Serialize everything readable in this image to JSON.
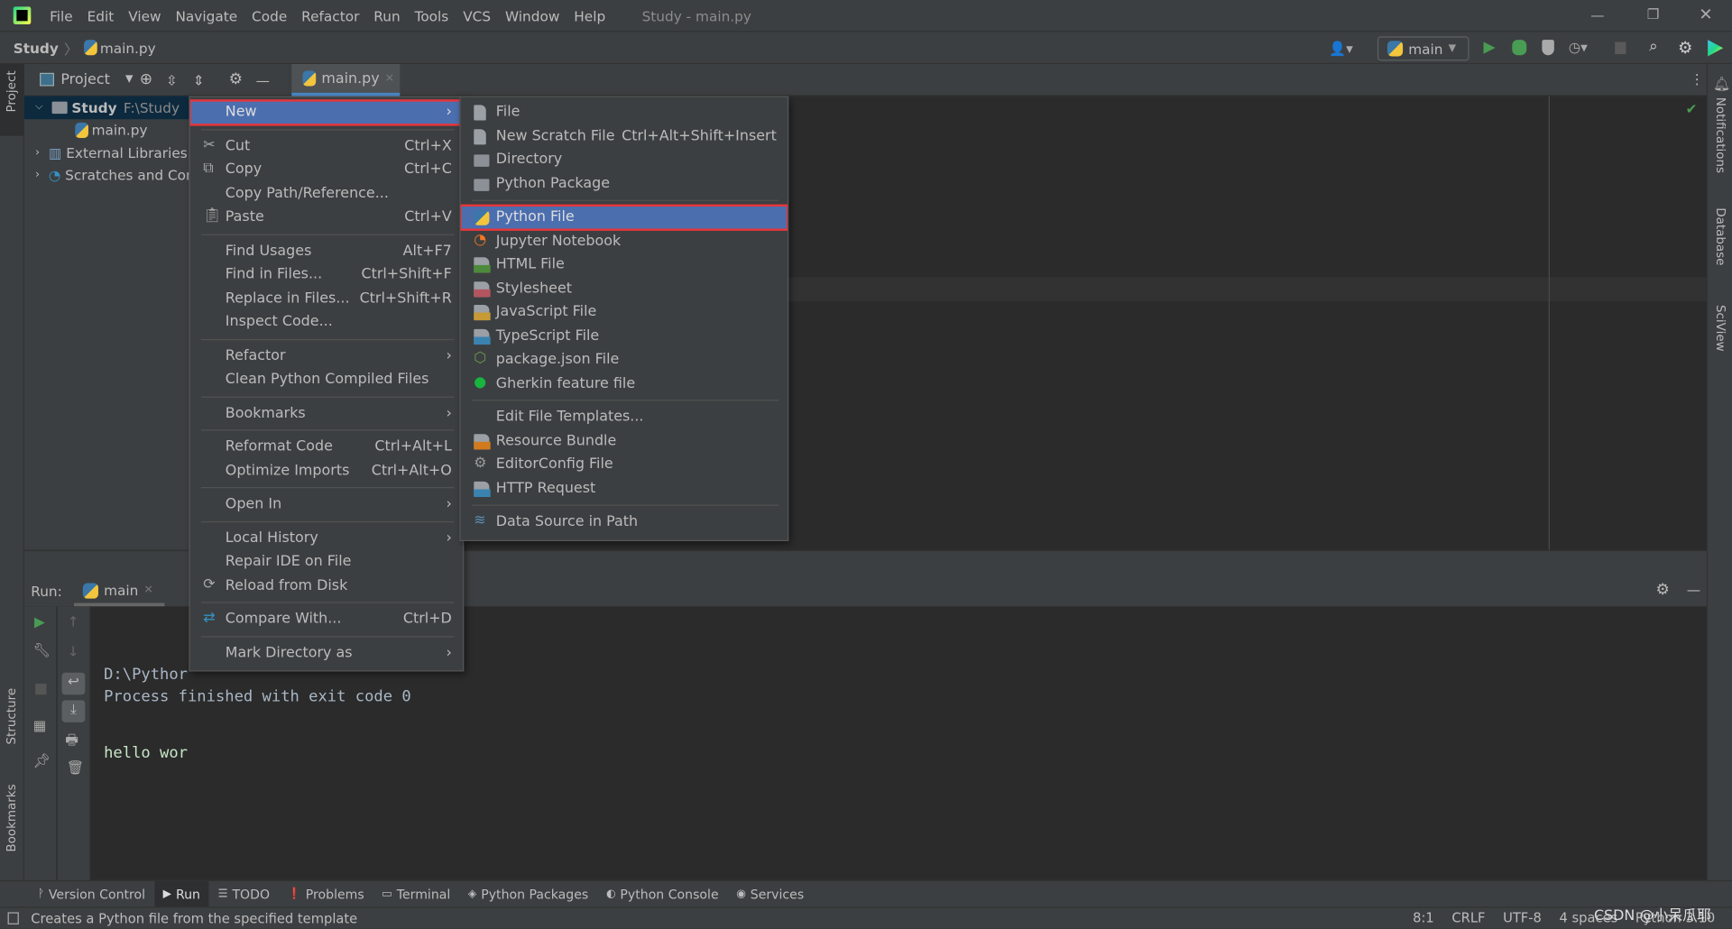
{
  "window": {
    "title": "Study - main.py",
    "menu": [
      "File",
      "Edit",
      "View",
      "Navigate",
      "Code",
      "Refactor",
      "Run",
      "Tools",
      "VCS",
      "Window",
      "Help"
    ],
    "controls": [
      "minimize",
      "restore",
      "close"
    ]
  },
  "navbar": {
    "project": "Study",
    "file": "main.py",
    "run_config": "main"
  },
  "left_stripe": {
    "top": "Project",
    "structure": "Structure",
    "bookmarks": "Bookmarks"
  },
  "right_stripe": [
    "Notifications",
    "Database",
    "SciView"
  ],
  "project_panel": {
    "title": "Project",
    "tree": [
      {
        "name": "Study",
        "path": "F:\\Study"
      },
      {
        "name": "main.py"
      },
      {
        "name": "External Libraries"
      },
      {
        "name": "Scratches and Consoles"
      }
    ]
  },
  "editor": {
    "tab": "main.py"
  },
  "run_panel": {
    "label": "Run:",
    "tab": "main",
    "lines": [
      "D:\\Pythor",
      "hello wor",
      "",
      "Process finished with exit code 0"
    ]
  },
  "context_menu": [
    {
      "label": "New",
      "submenu": true,
      "selected": true
    },
    {
      "sep": true
    },
    {
      "label": "Cut",
      "shortcut": "Ctrl+X",
      "icon": "scissors-icon"
    },
    {
      "label": "Copy",
      "shortcut": "Ctrl+C",
      "icon": "copy-icon"
    },
    {
      "label": "Copy Path/Reference..."
    },
    {
      "label": "Paste",
      "shortcut": "Ctrl+V",
      "icon": "clipboard-icon"
    },
    {
      "sep": true
    },
    {
      "label": "Find Usages",
      "shortcut": "Alt+F7"
    },
    {
      "label": "Find in Files...",
      "shortcut": "Ctrl+Shift+F"
    },
    {
      "label": "Replace in Files...",
      "shortcut": "Ctrl+Shift+R"
    },
    {
      "label": "Inspect Code..."
    },
    {
      "sep": true
    },
    {
      "label": "Refactor",
      "submenu": true
    },
    {
      "label": "Clean Python Compiled Files"
    },
    {
      "sep": true
    },
    {
      "label": "Bookmarks",
      "submenu": true
    },
    {
      "sep": true
    },
    {
      "label": "Reformat Code",
      "shortcut": "Ctrl+Alt+L"
    },
    {
      "label": "Optimize Imports",
      "shortcut": "Ctrl+Alt+O"
    },
    {
      "sep": true
    },
    {
      "label": "Open In",
      "submenu": true
    },
    {
      "sep": true
    },
    {
      "label": "Local History",
      "submenu": true
    },
    {
      "label": "Repair IDE on File"
    },
    {
      "label": "Reload from Disk",
      "icon": "reload-icon"
    },
    {
      "sep": true
    },
    {
      "label": "Compare With...",
      "shortcut": "Ctrl+D",
      "icon": "compare-icon"
    },
    {
      "sep": true
    },
    {
      "label": "Mark Directory as",
      "submenu": true
    }
  ],
  "new_submenu": [
    {
      "label": "File",
      "icon": "file-icon"
    },
    {
      "label": "New Scratch File",
      "shortcut": "Ctrl+Alt+Shift+Insert",
      "icon": "scratch-file-icon"
    },
    {
      "label": "Directory",
      "icon": "folder-icon"
    },
    {
      "label": "Python Package",
      "icon": "package-icon"
    },
    {
      "sep": true
    },
    {
      "label": "Python File",
      "icon": "python-file-icon",
      "selected": true
    },
    {
      "label": "Jupyter Notebook",
      "icon": "jupyter-icon"
    },
    {
      "label": "HTML File",
      "icon": "html-file-icon"
    },
    {
      "label": "Stylesheet",
      "icon": "css-file-icon"
    },
    {
      "label": "JavaScript File",
      "icon": "js-file-icon"
    },
    {
      "label": "TypeScript File",
      "icon": "ts-file-icon"
    },
    {
      "label": "package.json File",
      "icon": "nodejs-icon"
    },
    {
      "label": "Gherkin feature file",
      "icon": "gherkin-icon"
    },
    {
      "sep": true
    },
    {
      "label": "Edit File Templates..."
    },
    {
      "label": "Resource Bundle",
      "icon": "resource-bundle-icon"
    },
    {
      "label": "EditorConfig File",
      "icon": "gear-icon"
    },
    {
      "label": "HTTP Request",
      "icon": "api-icon"
    },
    {
      "sep": true
    },
    {
      "label": "Data Source in Path",
      "icon": "database-icon"
    }
  ],
  "bottom_tools": [
    "Version Control",
    "Run",
    "TODO",
    "Problems",
    "Terminal",
    "Python Packages",
    "Python Console",
    "Services"
  ],
  "status": {
    "message": "Creates a Python file from the specified template",
    "position": "8:1",
    "line_sep": "CRLF",
    "encoding": "UTF-8",
    "indent": "4 spaces",
    "interpreter": "Python 3.10",
    "watermark": "CSDN @小呆瓜耶"
  },
  "colors": {
    "selection": "#4b6eaf",
    "highlight_border": "#e8353a",
    "run_green": "#499c54"
  }
}
